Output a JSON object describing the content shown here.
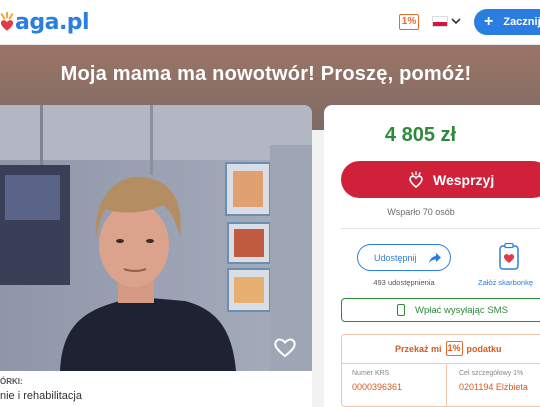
{
  "header": {
    "logo_text": "aga.pl",
    "tax_badge": "1%",
    "language": "pl",
    "start_button_label": "Zacznij zb"
  },
  "campaign": {
    "title": "Moja mama ma nowotwór! Proszę, pomóż!",
    "category_label": "ÓRKI:",
    "category_value": "nie i rehabilitacja"
  },
  "donation": {
    "amount": "4 805 zł",
    "support_button_label": "Wesprzyj",
    "supported_text": "Wsparło 70 osób",
    "share_button_label": "Udostępnij",
    "share_count_text": "493 udostępnienia",
    "piggybank_label": "Załóż skarbonkę",
    "sms_button_label": "Wpłać wysyłając SMS"
  },
  "tax": {
    "heading_prefix": "Przekaż mi",
    "heading_badge": "1%",
    "heading_suffix": "podatku",
    "krs_label": "Numer KRS",
    "krs_value": "0000396361",
    "goal_label": "Cel szczegółowy 1%",
    "goal_value": "0201194 Elżbieta"
  },
  "colors": {
    "brand_blue": "#2a7de1",
    "donate_red": "#d0213a",
    "amount_green": "#2e8a3a",
    "tax_orange": "#e66b2f"
  }
}
